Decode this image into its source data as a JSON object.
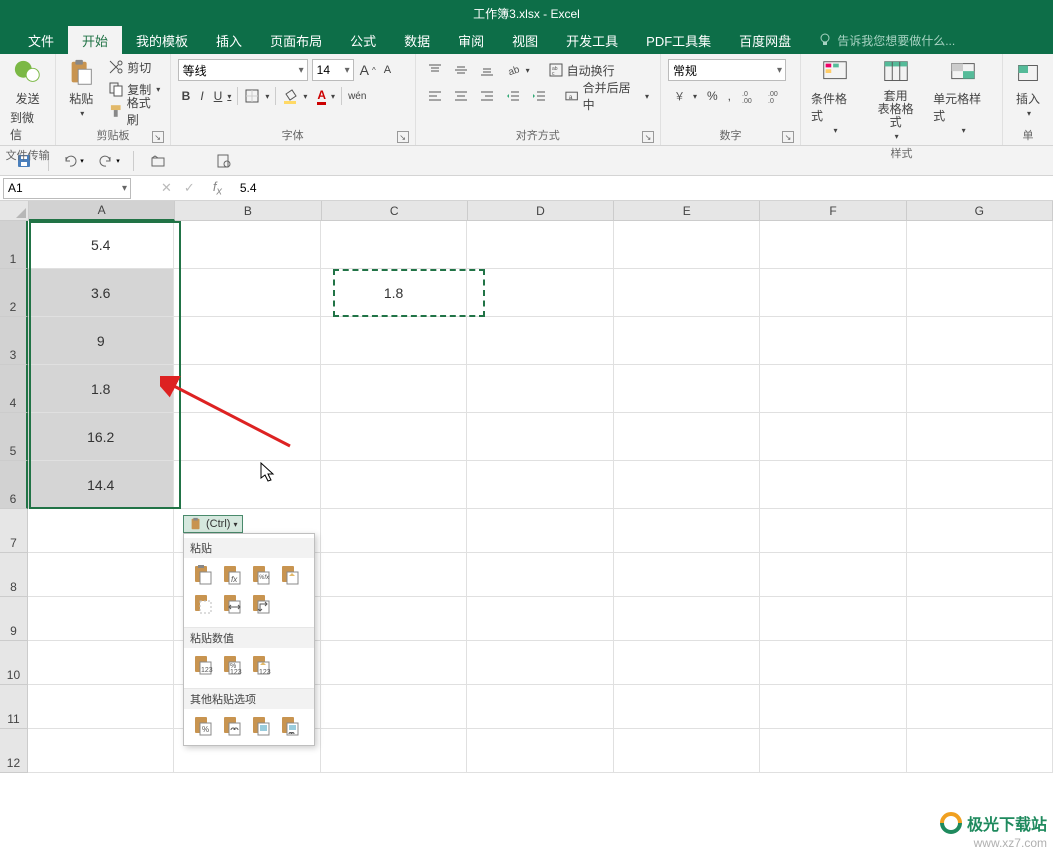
{
  "title": "工作簿3.xlsx - Excel",
  "tabs": [
    "文件",
    "开始",
    "我的模板",
    "插入",
    "页面布局",
    "公式",
    "数据",
    "审阅",
    "视图",
    "开发工具",
    "PDF工具集",
    "百度网盘"
  ],
  "active_tab": 1,
  "tellme": "告诉我您想要做什么...",
  "ribbon": {
    "group_wechat": {
      "label": "文件传输",
      "send": "发送",
      "to": "到微信"
    },
    "group_clipboard": {
      "label": "剪贴板",
      "paste": "粘贴",
      "cut": "剪切",
      "copy": "复制",
      "painter": "格式刷"
    },
    "group_font": {
      "label": "字体",
      "name": "等线",
      "size": "14",
      "inc": "A",
      "dec": "A",
      "bold": "B",
      "italic": "I",
      "underline": "U",
      "wen": "wén"
    },
    "group_align": {
      "label": "对齐方式",
      "wrap": "自动换行",
      "merge": "合并后居中"
    },
    "group_number": {
      "label": "数字",
      "format": "常规"
    },
    "group_styles": {
      "label": "样式",
      "cf": "条件格式",
      "ft": "套用\n表格格式",
      "cs": "单元格样式"
    },
    "group_insert": {
      "label": "单",
      "insert": "插入"
    }
  },
  "namebox": "A1",
  "formula": "5.4",
  "columns": [
    "A",
    "B",
    "C",
    "D",
    "E",
    "F",
    "G"
  ],
  "row_count": 12,
  "cells": {
    "A1": "5.4",
    "A2": "3.6",
    "A3": "9",
    "A4": "1.8",
    "A5": "16.2",
    "A6": "14.4",
    "C2": "1.8"
  },
  "paste_tag": "(Ctrl)",
  "paste_popup": {
    "sec1": "粘贴",
    "sec2": "粘贴数值",
    "sec3": "其他粘贴选项",
    "vals": [
      "123",
      "123",
      "123"
    ]
  },
  "watermark": {
    "top": "极光下载站",
    "bot": "www.xz7.com"
  }
}
